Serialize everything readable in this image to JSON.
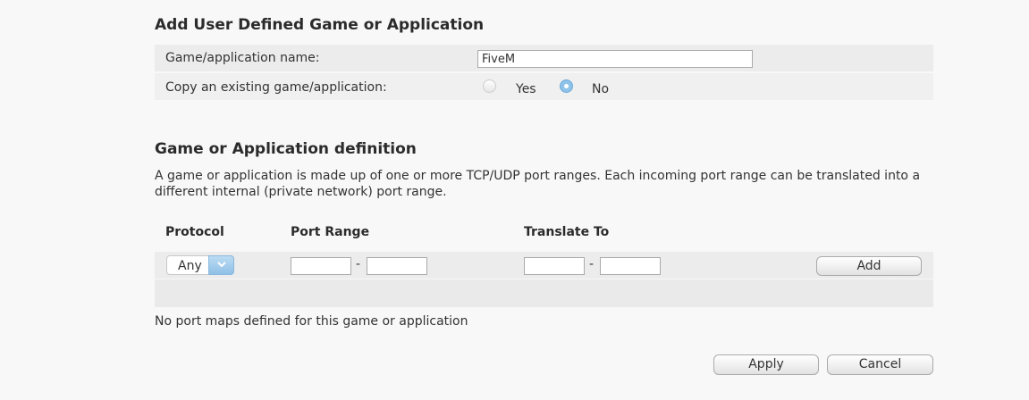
{
  "section1": {
    "title": "Add User Defined Game or Application",
    "name_label": "Game/application name:",
    "name_value": "FiveM",
    "copy_label": "Copy an existing game/application:",
    "copy_options": [
      "Yes",
      "No"
    ],
    "copy_selected": "No"
  },
  "section2": {
    "title": "Game or Application definition",
    "description": "A game or application is made up of one or more TCP/UDP port ranges. Each incoming port range can be translated into a different internal (private network) port range.",
    "columns": {
      "protocol": "Protocol",
      "port_range": "Port Range",
      "translate_to": "Translate To"
    },
    "protocol_selected": "Any",
    "range_separator": "-",
    "add_label": "Add",
    "empty_note": "No port maps defined for this game or application"
  },
  "footer": {
    "apply_label": "Apply",
    "cancel_label": "Cancel"
  },
  "colors": {
    "accent": "#8fc3ea",
    "row_shade": "#ececec",
    "background": "#f8f8f8"
  }
}
